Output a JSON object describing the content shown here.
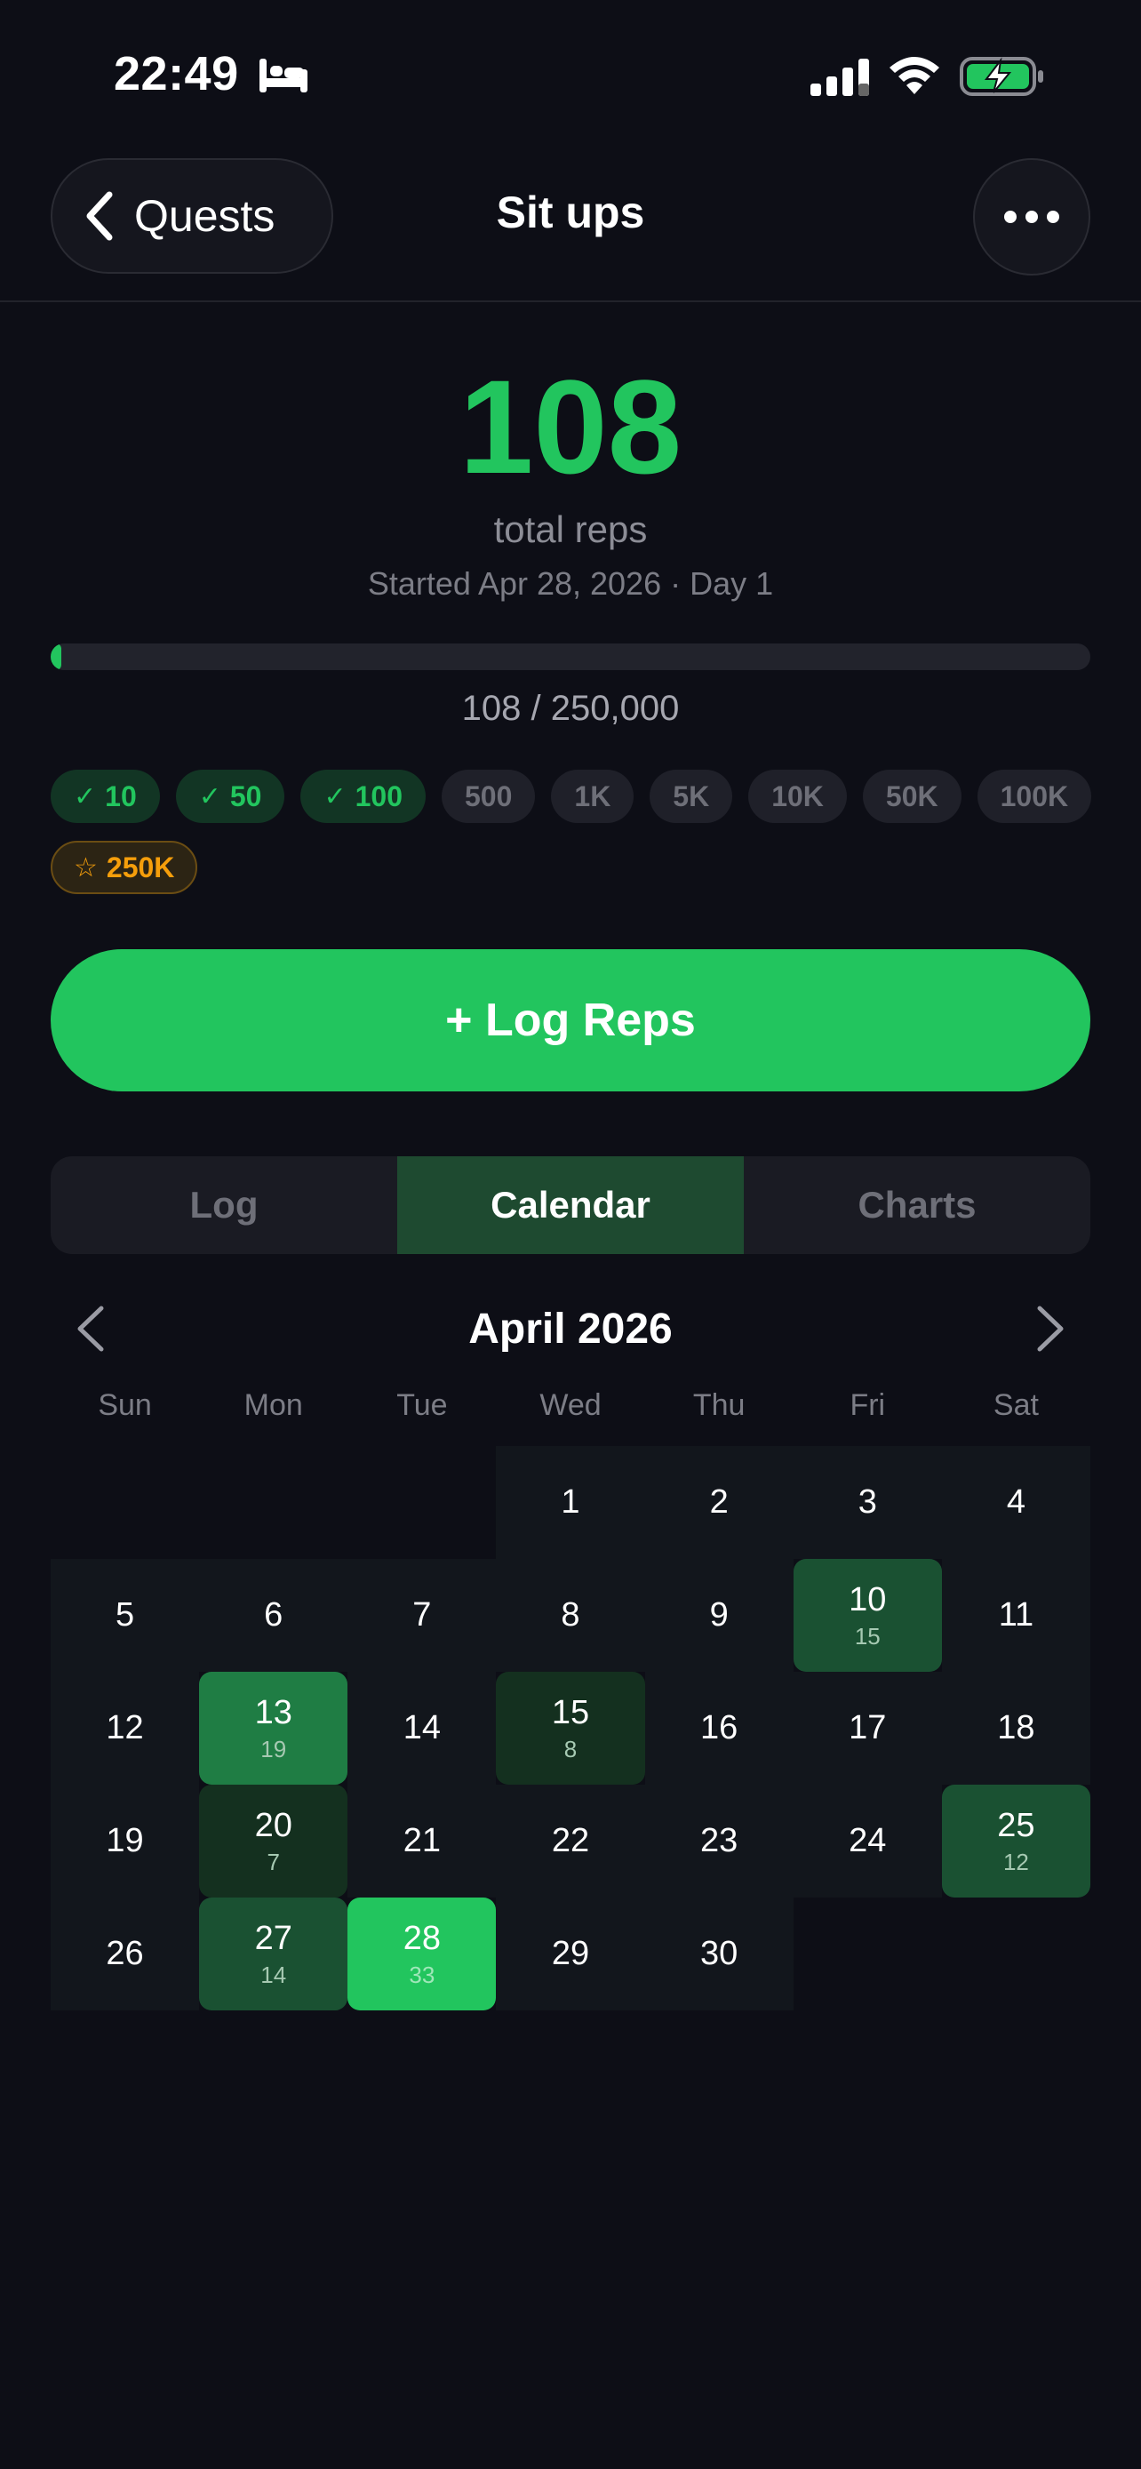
{
  "status": {
    "time": "22:49"
  },
  "nav": {
    "back_label": "Quests",
    "title": "Sit ups"
  },
  "hero": {
    "total": "108",
    "total_label": "total reps",
    "started": "Started Apr 28, 2026 · Day 1"
  },
  "progress": {
    "text": "108 / 250,000",
    "fraction": 0.000432
  },
  "milestones": [
    {
      "label": "10",
      "state": "done"
    },
    {
      "label": "50",
      "state": "done"
    },
    {
      "label": "100",
      "state": "done"
    },
    {
      "label": "500",
      "state": "locked"
    },
    {
      "label": "1K",
      "state": "locked"
    },
    {
      "label": "5K",
      "state": "locked"
    },
    {
      "label": "10K",
      "state": "locked"
    },
    {
      "label": "50K",
      "state": "locked"
    },
    {
      "label": "100K",
      "state": "locked"
    },
    {
      "label": "250K",
      "state": "target"
    }
  ],
  "log_button": "+ Log Reps",
  "tabs": [
    {
      "label": "Log",
      "active": false
    },
    {
      "label": "Calendar",
      "active": true
    },
    {
      "label": "Charts",
      "active": false
    }
  ],
  "calendar": {
    "month": "April 2026",
    "weekdays": [
      "Sun",
      "Mon",
      "Tue",
      "Wed",
      "Thu",
      "Fri",
      "Sat"
    ],
    "first_weekday": 3,
    "days": [
      {
        "d": "1"
      },
      {
        "d": "2"
      },
      {
        "d": "3"
      },
      {
        "d": "4"
      },
      {
        "d": "5"
      },
      {
        "d": "6"
      },
      {
        "d": "7"
      },
      {
        "d": "8"
      },
      {
        "d": "9"
      },
      {
        "d": "10",
        "count": "15",
        "level": 2
      },
      {
        "d": "11"
      },
      {
        "d": "12"
      },
      {
        "d": "13",
        "count": "19",
        "level": 3
      },
      {
        "d": "14"
      },
      {
        "d": "15",
        "count": "8",
        "level": 1
      },
      {
        "d": "16"
      },
      {
        "d": "17"
      },
      {
        "d": "18"
      },
      {
        "d": "19"
      },
      {
        "d": "20",
        "count": "7",
        "level": 1
      },
      {
        "d": "21"
      },
      {
        "d": "22"
      },
      {
        "d": "23"
      },
      {
        "d": "24"
      },
      {
        "d": "25",
        "count": "12",
        "level": 2
      },
      {
        "d": "26"
      },
      {
        "d": "27",
        "count": "14",
        "level": 2
      },
      {
        "d": "28",
        "count": "33",
        "level": 4
      },
      {
        "d": "29"
      },
      {
        "d": "30"
      }
    ]
  },
  "colors": {
    "accent": "#22c55e",
    "target": "#f59e0b",
    "background": "#0d0e16"
  }
}
